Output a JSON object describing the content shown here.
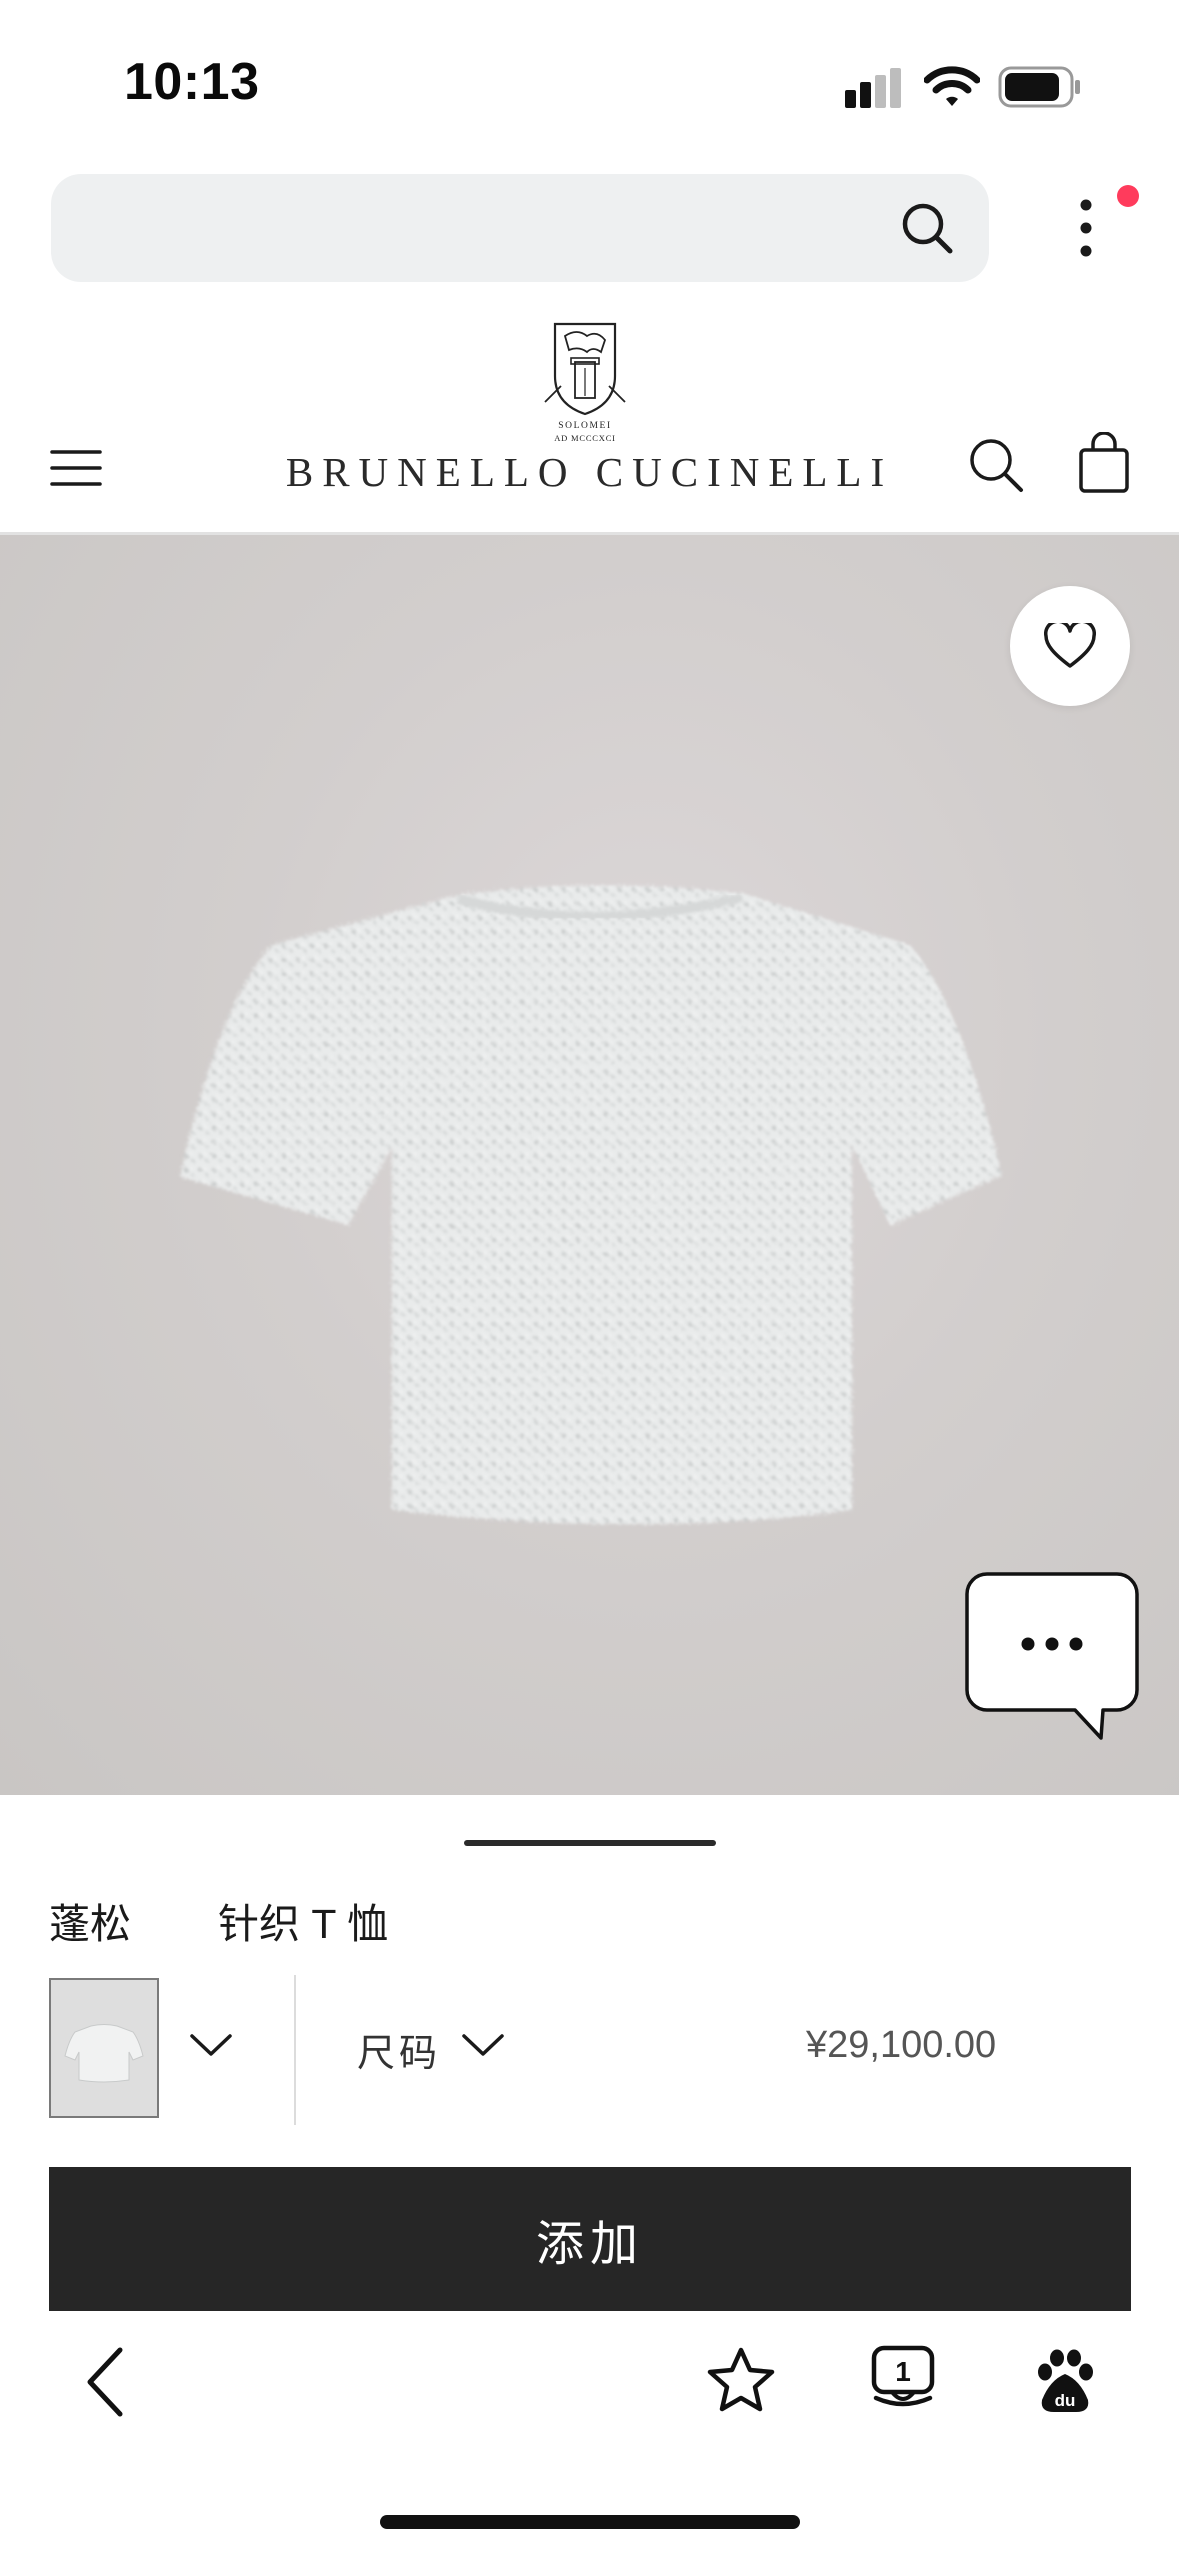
{
  "status_bar": {
    "time": "10:13"
  },
  "search": {
    "placeholder": ""
  },
  "brand": {
    "name": "BRUNELLO CUCINELLI",
    "logo_top_text": "SOLOMEI",
    "logo_bottom_text": "AD MCCCXCI"
  },
  "product": {
    "name_parts": [
      "蓬松",
      "针织 T 恤"
    ],
    "size_label": "尺码",
    "price": "¥29,100.00",
    "add_button_label": "添加"
  },
  "browser_toolbar": {
    "tab_count": "1"
  },
  "icons": {
    "signal": "signal-icon",
    "wifi": "wifi-icon",
    "battery": "battery-icon",
    "search": "search-icon",
    "more": "more-vertical-icon",
    "menu": "hamburger-menu-icon",
    "bag": "shopping-bag-icon",
    "favorite": "heart-icon",
    "chat": "chat-bubble-icon",
    "chevron": "chevron-down-icon",
    "back": "back-arrow-icon",
    "bookmark": "star-icon",
    "tabs": "tabs-icon",
    "baidu": "baidu-paw-icon"
  },
  "colors": {
    "notification_dot": "#ff3b5c",
    "add_button_bg": "#262626",
    "search_bar_bg": "#eef0f1"
  }
}
